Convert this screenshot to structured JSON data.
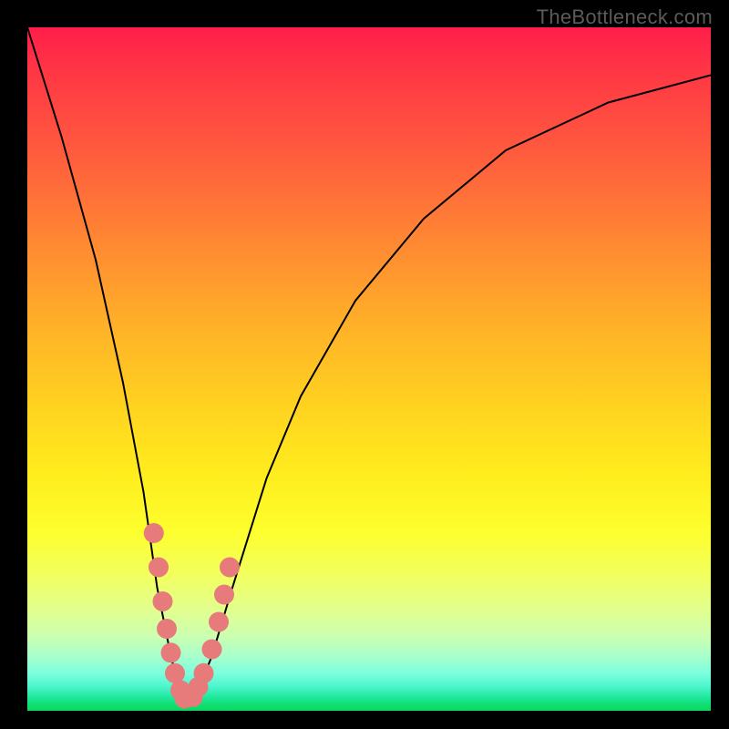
{
  "watermark": "TheBottleneck.com",
  "chart_data": {
    "type": "line",
    "title": "",
    "xlabel": "",
    "ylabel": "",
    "xlim": [
      0,
      100
    ],
    "ylim": [
      0,
      100
    ],
    "note": "V-shaped bottleneck curve; minimum near x≈23, y≈0. Gradient background runs from red (top / high bottleneck) to green (bottom / low bottleneck).",
    "series": [
      {
        "name": "bottleneck-curve",
        "x": [
          0,
          5,
          10,
          14,
          17,
          19,
          21,
          22.5,
          23.5,
          25,
          27,
          30,
          35,
          40,
          48,
          58,
          70,
          85,
          100
        ],
        "y": [
          100,
          84,
          66,
          48,
          32,
          18,
          8,
          2,
          1.5,
          3,
          8,
          18,
          34,
          46,
          60,
          72,
          82,
          89,
          93
        ]
      }
    ],
    "markers": [
      {
        "name": "left-cluster",
        "color": "#e77a7a",
        "points": [
          {
            "x": 18.5,
            "y": 26
          },
          {
            "x": 19.2,
            "y": 21
          },
          {
            "x": 19.8,
            "y": 16
          },
          {
            "x": 20.4,
            "y": 12
          },
          {
            "x": 21.0,
            "y": 8.5
          },
          {
            "x": 21.6,
            "y": 5.5
          },
          {
            "x": 22.4,
            "y": 3
          },
          {
            "x": 23.0,
            "y": 1.8
          }
        ]
      },
      {
        "name": "right-cluster",
        "color": "#e77a7a",
        "points": [
          {
            "x": 24.2,
            "y": 2.0
          },
          {
            "x": 25.0,
            "y": 3.5
          },
          {
            "x": 25.8,
            "y": 5.5
          },
          {
            "x": 27.0,
            "y": 9
          },
          {
            "x": 28.0,
            "y": 13
          },
          {
            "x": 28.8,
            "y": 17
          },
          {
            "x": 29.6,
            "y": 21
          }
        ]
      }
    ],
    "gradient_stops": [
      {
        "pos": 0,
        "color": "#ff1e4a"
      },
      {
        "pos": 0.5,
        "color": "#ffe01e"
      },
      {
        "pos": 1.0,
        "color": "#0cd95b"
      }
    ]
  }
}
